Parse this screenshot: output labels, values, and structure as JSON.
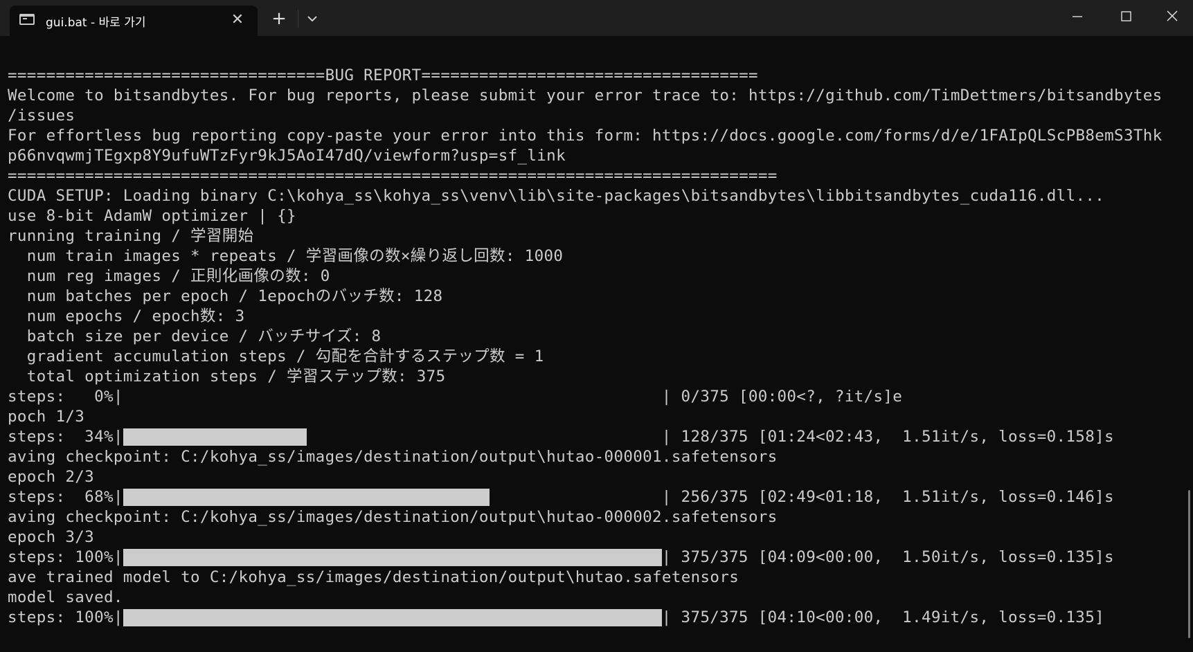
{
  "window": {
    "tab_title": "gui.bat - 바로 가기",
    "tab_icon": "terminal-icon",
    "new_tab_symbol": "+",
    "close_tab_symbol": "✕"
  },
  "terminal": {
    "lines": [
      "=================================BUG REPORT===================================",
      "Welcome to bitsandbytes. For bug reports, please submit your error trace to: https://github.com/TimDettmers/bitsandbytes",
      "/issues",
      "For effortless bug reporting copy-paste your error into this form: https://docs.google.com/forms/d/e/1FAIpQLScPB8emS3Thk",
      "p66nvqwmjTEgxp8Y9ufuWTzFyr9kJ5AoI47dQ/viewform?usp=sf_link",
      "================================================================================",
      "CUDA SETUP: Loading binary C:\\kohya_ss\\kohya_ss\\venv\\lib\\site-packages\\bitsandbytes\\libbitsandbytes_cuda116.dll...",
      "use 8-bit AdamW optimizer | {}",
      "running training / 学習開始",
      "  num train images * repeats / 学習画像の数×繰り返し回数: 1000",
      "  num reg images / 正則化画像の数: 0",
      "  num batches per epoch / 1epochのバッチ数: 128",
      "  num epochs / epoch数: 3",
      "  batch size per device / バッチサイズ: 8",
      "  gradient accumulation steps / 勾配を合計するステップ数 = 1",
      "  total optimization steps / 学習ステップ数: 375"
    ],
    "progress": [
      {
        "label": "steps:   0%|",
        "percent": 0,
        "stats": "| 0/375 [00:00<?, ?it/s]e",
        "after": [
          "poch 1/3"
        ]
      },
      {
        "label": "steps:  34%|",
        "percent": 34,
        "stats": "| 128/375 [01:24<02:43,  1.51it/s, loss=0.158]s",
        "after": [
          "aving checkpoint: C:/kohya_ss/images/destination/output\\hutao-000001.safetensors",
          "epoch 2/3"
        ]
      },
      {
        "label": "steps:  68%|",
        "percent": 68,
        "stats": "| 256/375 [02:49<01:18,  1.51it/s, loss=0.146]s",
        "after": [
          "aving checkpoint: C:/kohya_ss/images/destination/output\\hutao-000002.safetensors",
          "epoch 3/3"
        ]
      },
      {
        "label": "steps: 100%|",
        "percent": 100,
        "stats": "| 375/375 [04:09<00:00,  1.50it/s, loss=0.135]s",
        "after": [
          "ave trained model to C:/kohya_ss/images/destination/output\\hutao.safetensors",
          "model saved."
        ]
      },
      {
        "label": "steps: 100%|",
        "percent": 100,
        "stats": "| 375/375 [04:10<00:00,  1.49it/s, loss=0.135]",
        "after": []
      }
    ]
  },
  "colors": {
    "background": "#0c0c0c",
    "titlebar": "#1f1f1f",
    "text": "#cccccc",
    "progress_fill": "#cccccc"
  }
}
